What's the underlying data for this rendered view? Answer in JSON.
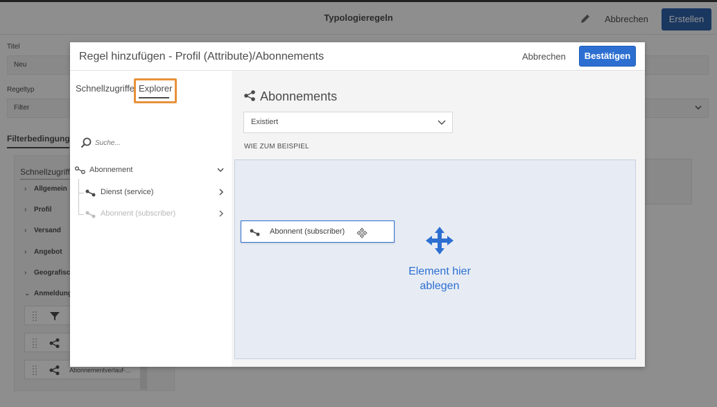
{
  "page": {
    "title": "Typologieregeln",
    "cancel_label": "Abbrechen",
    "create_label": "Erstellen"
  },
  "form": {
    "title_label": "Titel",
    "title_value": "Neu",
    "ruletype_label": "Regeltyp",
    "ruletype_value": "Filter",
    "section_tab": "Filterbedingungen"
  },
  "bg_panel": {
    "heading": "Schnellzugriffe",
    "categories": [
      "Allgemein",
      "Profil",
      "Versand",
      "Angebot",
      "Geografisc",
      "Anmeldung"
    ],
    "drag_items": [
      "",
      "",
      "Abonnementverlauf-..."
    ]
  },
  "modal": {
    "title": "Regel hinzufügen - Profil (Attribute)/Abonnements",
    "cancel_label": "Abbrechen",
    "confirm_label": "Bestätigen",
    "tabs": [
      "Schnellzugriffe",
      "Explorer"
    ],
    "search_placeholder": "Suche...",
    "tree": [
      {
        "label": "Abonnement",
        "state": "expanded"
      },
      {
        "label": "Dienst (service)",
        "state": "collapsed"
      },
      {
        "label": "Abonnent (subscriber)",
        "state": "collapsed"
      }
    ],
    "right": {
      "heading": "Abonnements",
      "select_value": "Existiert",
      "example_label": "WIE ZUM BEISPIEL",
      "drop_text_line1": "Element hier",
      "drop_text_line2": "ablegen",
      "dragged_item": "Abonnent (subscriber)"
    }
  },
  "colors": {
    "primary": "#2d6fd1",
    "highlight": "#e8913a",
    "dropzone": "#e7ecf4"
  }
}
